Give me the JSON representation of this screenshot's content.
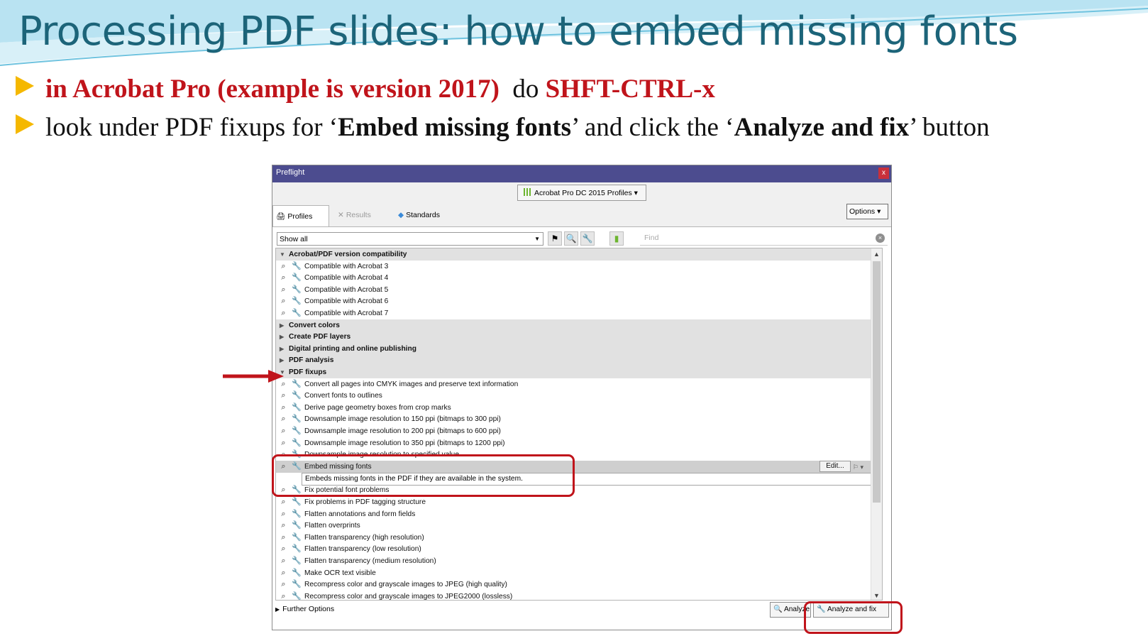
{
  "slide": {
    "title": "Processing PDF slides: how to embed missing fonts",
    "bullet1": {
      "part1": "in Acrobat Pro (example is version 2017)",
      "part2": "do",
      "part3": "SHFT-CTRL-x"
    },
    "bullet2": {
      "part1": "look under PDF fixups for ‘",
      "part2": "Embed missing fonts",
      "part3": "’ and click the ‘",
      "part4": "Analyze and fix",
      "part5": "’ button"
    }
  },
  "window": {
    "title": "Preflight",
    "close": "x",
    "profile_dropdown": "Acrobat Pro DC 2015 Profiles",
    "tabs": {
      "profiles": "Profiles",
      "results": "Results",
      "standards": "Standards"
    },
    "options": "Options",
    "filter": "Show all",
    "find_placeholder": "Find",
    "categories": {
      "compat": "Acrobat/PDF version compatibility",
      "colors": "Convert colors",
      "layers": "Create PDF layers",
      "digital": "Digital printing and online publishing",
      "analysis": "PDF analysis",
      "fixups": "PDF fixups"
    },
    "compat_items": [
      "Compatible with Acrobat 3",
      "Compatible with Acrobat 4",
      "Compatible with Acrobat 5",
      "Compatible with Acrobat 6",
      "Compatible with Acrobat 7"
    ],
    "fixup_items_before": [
      "Convert all pages into CMYK images and preserve text information",
      "Convert fonts to outlines",
      "Derive page geometry boxes from crop marks",
      "Downsample image resolution to 150 ppi (bitmaps to 300 ppi)",
      "Downsample image resolution to 200 ppi (bitmaps to 600 ppi)",
      "Downsample image resolution to 350 ppi (bitmaps to 1200 ppi)",
      "Downsample image resolution to specified value"
    ],
    "selected_item": "Embed missing fonts",
    "edit_button": "Edit...",
    "selected_description": "Embeds missing fonts in the PDF if they are available in the system.",
    "fixup_items_after": [
      "Fix potential font problems",
      "Fix problems in PDF tagging structure",
      "Flatten annotations and form fields",
      "Flatten overprints",
      "Flatten transparency (high resolution)",
      "Flatten transparency (low resolution)",
      "Flatten transparency (medium resolution)",
      "Make OCR text visible",
      "Recompress color and grayscale images to JPEG (high quality)",
      "Recompress color and grayscale images to JPEG2000 (lossless)"
    ],
    "further_options": "Further Options",
    "analyze_button": "Analyze",
    "analyze_fix_button": "Analyze and fix"
  },
  "colors": {
    "title": "#1c6479",
    "accent_red": "#c0141b",
    "bullet_triangle": "#f5b800",
    "window_titlebar": "#4c4c8f"
  },
  "icons": [
    "bullet-triangle-icon",
    "printer-profile-icon",
    "results-icon",
    "standards-diamond-icon",
    "magnifier-icon",
    "wrench-icon",
    "chart-bars-icon",
    "clear-icon",
    "arrow-pointer-icon"
  ]
}
